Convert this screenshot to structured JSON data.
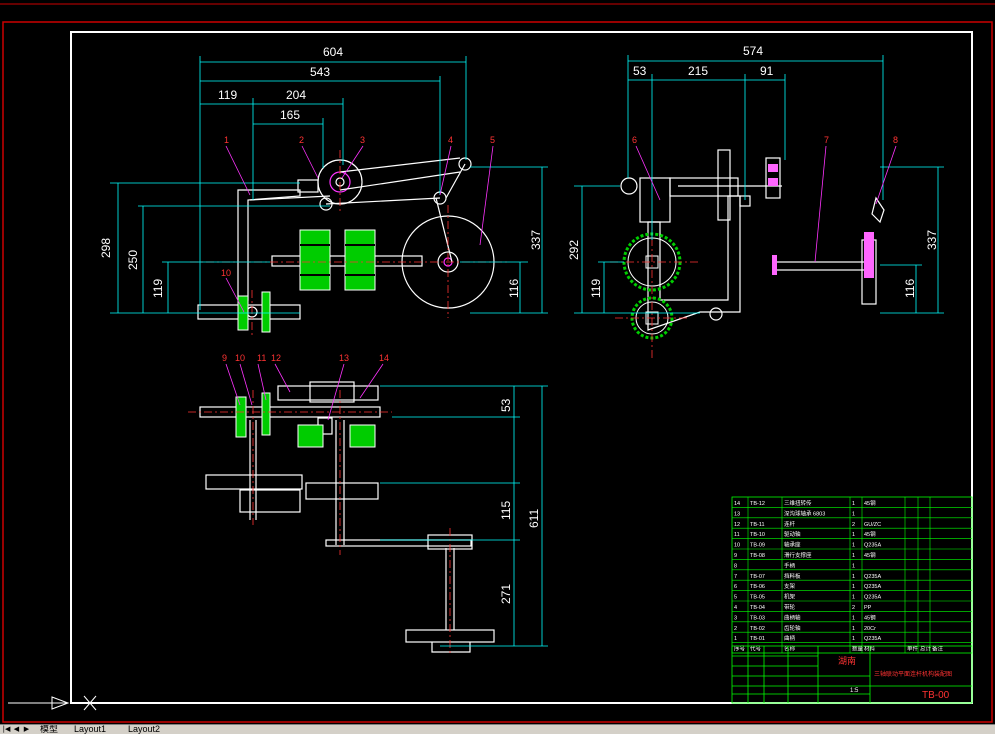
{
  "colors": {
    "background": "#000000",
    "border_red": "#cc0000",
    "frame": "#ffffff",
    "dimension": "#00ffff",
    "leader": "#ff00ff",
    "label": "#ff3333",
    "part": "#ffffff",
    "hatch": "#00cc00",
    "center": "#ff3333",
    "table": "#00ff00",
    "title_text": "#ff3333"
  },
  "front_view": {
    "dims_horizontal": [
      "604",
      "543",
      "119",
      "204",
      "165"
    ],
    "dims_vertical": [
      "298",
      "250",
      "119",
      "337",
      "116"
    ],
    "balloons": [
      "1",
      "2",
      "3",
      "4",
      "5",
      "10"
    ]
  },
  "side_view": {
    "dims_horizontal": [
      "574",
      "53",
      "215",
      "91"
    ],
    "dims_vertical": [
      "292",
      "119",
      "337",
      "116"
    ],
    "balloons": [
      "6",
      "7",
      "8"
    ]
  },
  "top_view": {
    "dims_vertical": [
      "53",
      "611",
      "115",
      "271"
    ],
    "balloons": [
      "9",
      "10",
      "11",
      "12",
      "13",
      "14"
    ]
  },
  "parts_table": {
    "rows": [
      {
        "no": "14",
        "code": "TB-12",
        "name": "三维扭转传",
        "qty": "1",
        "mat": "45钢"
      },
      {
        "no": "13",
        "code": "",
        "name": "深沟球轴承 6803",
        "qty": "1",
        "mat": ""
      },
      {
        "no": "12",
        "code": "TB-11",
        "name": "连杆",
        "qty": "2",
        "mat": "GU/ZC"
      },
      {
        "no": "11",
        "code": "TB-10",
        "name": "驱动轴",
        "qty": "1",
        "mat": "45钢"
      },
      {
        "no": "10",
        "code": "TB-09",
        "name": "轴承座",
        "qty": "1",
        "mat": "Q235A"
      },
      {
        "no": "9",
        "code": "TB-08",
        "name": "滑行支撑座",
        "qty": "1",
        "mat": "45钢"
      },
      {
        "no": "8",
        "code": "",
        "name": "手柄",
        "qty": "1",
        "mat": ""
      },
      {
        "no": "7",
        "code": "TB-07",
        "name": "挡料板",
        "qty": "1",
        "mat": "Q235A"
      },
      {
        "no": "6",
        "code": "TB-06",
        "name": "支架",
        "qty": "1",
        "mat": "Q235A"
      },
      {
        "no": "5",
        "code": "TB-05",
        "name": "机架",
        "qty": "1",
        "mat": "Q235A"
      },
      {
        "no": "4",
        "code": "TB-04",
        "name": "带轮",
        "qty": "2",
        "mat": "PP"
      },
      {
        "no": "3",
        "code": "TB-03",
        "name": "曲柄轴",
        "qty": "1",
        "mat": "45钢"
      },
      {
        "no": "2",
        "code": "TB-02",
        "name": "齿轮轴",
        "qty": "1",
        "mat": "20Cr"
      },
      {
        "no": "1",
        "code": "TB-01",
        "name": "曲柄",
        "qty": "1",
        "mat": "Q235A"
      }
    ],
    "header": [
      "序号",
      "代号",
      "名称",
      "数量",
      "材料",
      "单件",
      "总计",
      "备注"
    ]
  },
  "title_block": {
    "stamp": "湖南",
    "title": "三轴联动平面连杆机构装配图",
    "drawing_no": "TB-00",
    "scale": "1:5"
  },
  "ucs_icon": "X",
  "tabs": [
    "模型",
    "Layout1",
    "Layout2"
  ]
}
